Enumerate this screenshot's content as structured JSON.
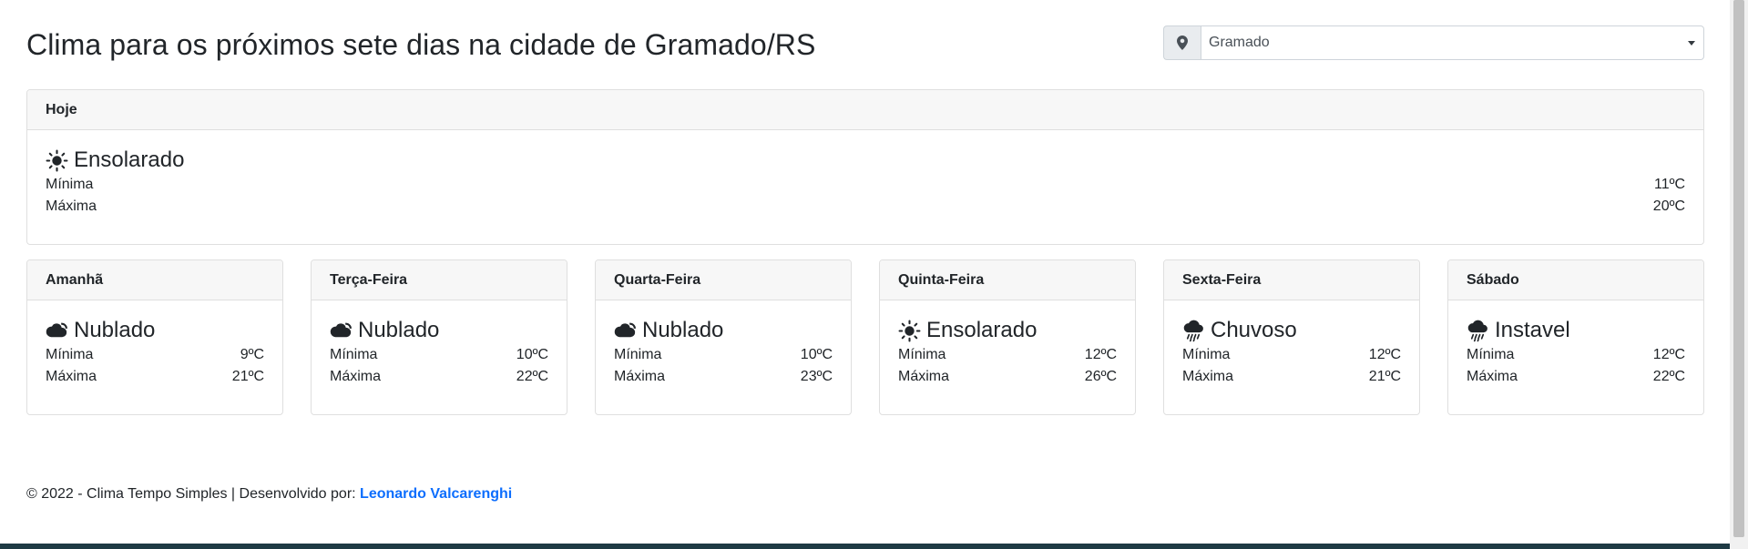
{
  "header": {
    "title": "Clima para os próximos sete dias na cidade de Gramado/RS",
    "city_select": {
      "value": "Gramado",
      "icon": "map-marker-icon"
    }
  },
  "today": {
    "label": "Hoje",
    "condition": "Ensolarado",
    "icon": "sun-icon",
    "min_label": "Mínima",
    "min_value": "11ºC",
    "max_label": "Máxima",
    "max_value": "20ºC"
  },
  "forecast": [
    {
      "day": "Amanhã",
      "condition": "Nublado",
      "icon": "cloud-icon",
      "min_label": "Mínima",
      "min_value": "9ºC",
      "max_label": "Máxima",
      "max_value": "21ºC"
    },
    {
      "day": "Terça-Feira",
      "condition": "Nublado",
      "icon": "cloud-icon",
      "min_label": "Mínima",
      "min_value": "10ºC",
      "max_label": "Máxima",
      "max_value": "22ºC"
    },
    {
      "day": "Quarta-Feira",
      "condition": "Nublado",
      "icon": "cloud-icon",
      "min_label": "Mínima",
      "min_value": "10ºC",
      "max_label": "Máxima",
      "max_value": "23ºC"
    },
    {
      "day": "Quinta-Feira",
      "condition": "Ensolarado",
      "icon": "sun-icon",
      "min_label": "Mínima",
      "min_value": "12ºC",
      "max_label": "Máxima",
      "max_value": "26ºC"
    },
    {
      "day": "Sexta-Feira",
      "condition": "Chuvoso",
      "icon": "rain-cloud-icon",
      "min_label": "Mínima",
      "min_value": "12ºC",
      "max_label": "Máxima",
      "max_value": "21ºC"
    },
    {
      "day": "Sábado",
      "condition": "Instavel",
      "icon": "rain-cloud-icon",
      "min_label": "Mínima",
      "min_value": "12ºC",
      "max_label": "Máxima",
      "max_value": "22ºC"
    }
  ],
  "footer": {
    "text": "© 2022 - Clima Tempo Simples | Desenvolvido por:",
    "author": "Leonardo Valcarenghi"
  },
  "colors": {
    "link": "#0d6efd",
    "card_header_bg": "#f7f7f7",
    "border": "#dfdfdf"
  }
}
